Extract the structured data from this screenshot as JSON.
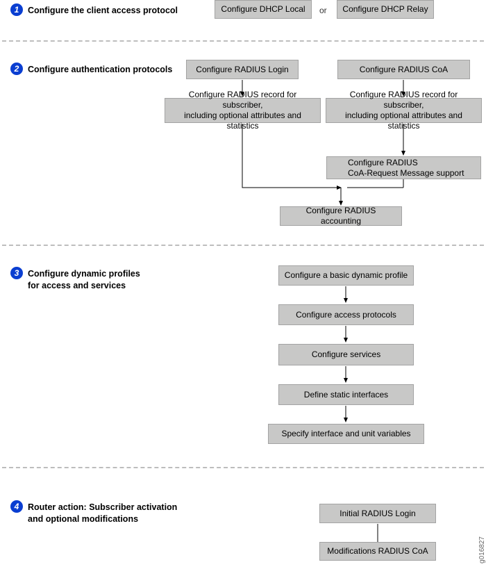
{
  "footer_id": "g016827",
  "step1": {
    "num": "1",
    "title": "Configure the client access protocol",
    "box_a": "Configure DHCP Local",
    "or": "or",
    "box_b": "Configure DHCP Relay"
  },
  "step2": {
    "num": "2",
    "title": "Configure authentication protocols",
    "login": "Configure RADIUS Login",
    "coa": "Configure RADIUS CoA",
    "record_left": "Configure RADIUS record for subscriber,\nincluding optional attributes and statistics",
    "record_right": "Configure RADIUS record for subscriber,\nincluding optional attributes and statistics",
    "coa_req": "Configure RADIUS\nCoA-Request Message support",
    "accounting": "Configure RADIUS accounting"
  },
  "step3": {
    "num": "3",
    "title_line1": "Configure dynamic profiles",
    "title_line2": "for access and services",
    "basic": "Configure a basic dynamic profile",
    "access": "Configure access protocols",
    "services": "Configure services",
    "static": "Define static interfaces",
    "vars": "Specify interface and unit variables"
  },
  "step4": {
    "num": "4",
    "title_line1": "Router action: Subscriber activation",
    "title_line2": "and optional modifications",
    "initial": "Initial RADIUS Login",
    "mods": "Modifications RADIUS CoA"
  }
}
